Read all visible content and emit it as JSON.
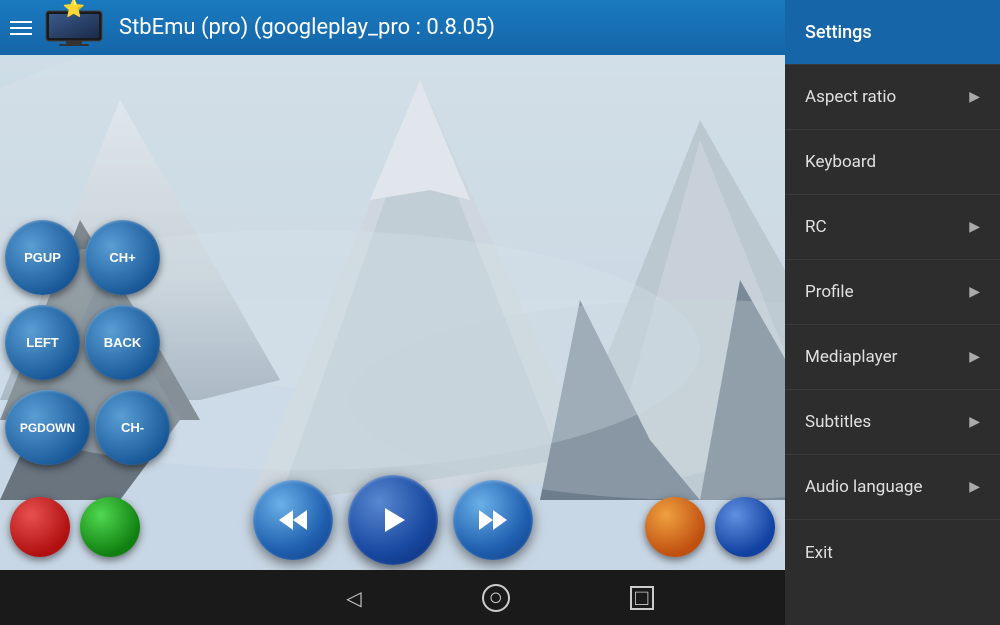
{
  "header": {
    "title": "StbEmu (pro) (googleplay_pro : 0.8.05)",
    "star": "⭐",
    "menu_icon": "menu"
  },
  "menu": {
    "items": [
      {
        "id": "settings",
        "label": "Settings",
        "has_arrow": false,
        "is_active": true
      },
      {
        "id": "aspect-ratio",
        "label": "Aspect ratio",
        "has_arrow": true
      },
      {
        "id": "keyboard",
        "label": "Keyboard",
        "has_arrow": false
      },
      {
        "id": "rc",
        "label": "RC",
        "has_arrow": true
      },
      {
        "id": "profile",
        "label": "Profile",
        "has_arrow": true
      },
      {
        "id": "mediaplayer",
        "label": "Mediaplayer",
        "has_arrow": true
      },
      {
        "id": "subtitles",
        "label": "Subtitles",
        "has_arrow": true
      },
      {
        "id": "audio-language",
        "label": "Audio language",
        "has_arrow": true
      },
      {
        "id": "exit",
        "label": "Exit",
        "has_arrow": false
      }
    ]
  },
  "nav_buttons": {
    "row1": [
      {
        "id": "pgup",
        "label": "PGUP"
      },
      {
        "id": "ch-plus",
        "label": "CH+"
      }
    ],
    "row2": [
      {
        "id": "left",
        "label": "LEFT"
      },
      {
        "id": "back",
        "label": "BACK"
      }
    ],
    "row3": [
      {
        "id": "pgdown",
        "label": "PGDOWN"
      },
      {
        "id": "ch-minus",
        "label": "CH-"
      }
    ]
  },
  "media_buttons": {
    "rewind": "⏮",
    "play": "▶",
    "forward": "⏭"
  },
  "color_buttons": {
    "left": [
      "red",
      "green"
    ],
    "right": [
      "orange",
      "blue"
    ]
  },
  "bottom_nav": {
    "back": "◁",
    "home": "○",
    "recent": "□"
  },
  "colors": {
    "header_bg": "#1565a8",
    "menu_bg": "#2d2d2d",
    "settings_highlight": "#1565a8",
    "btn_blue": "#1a5a9a"
  }
}
